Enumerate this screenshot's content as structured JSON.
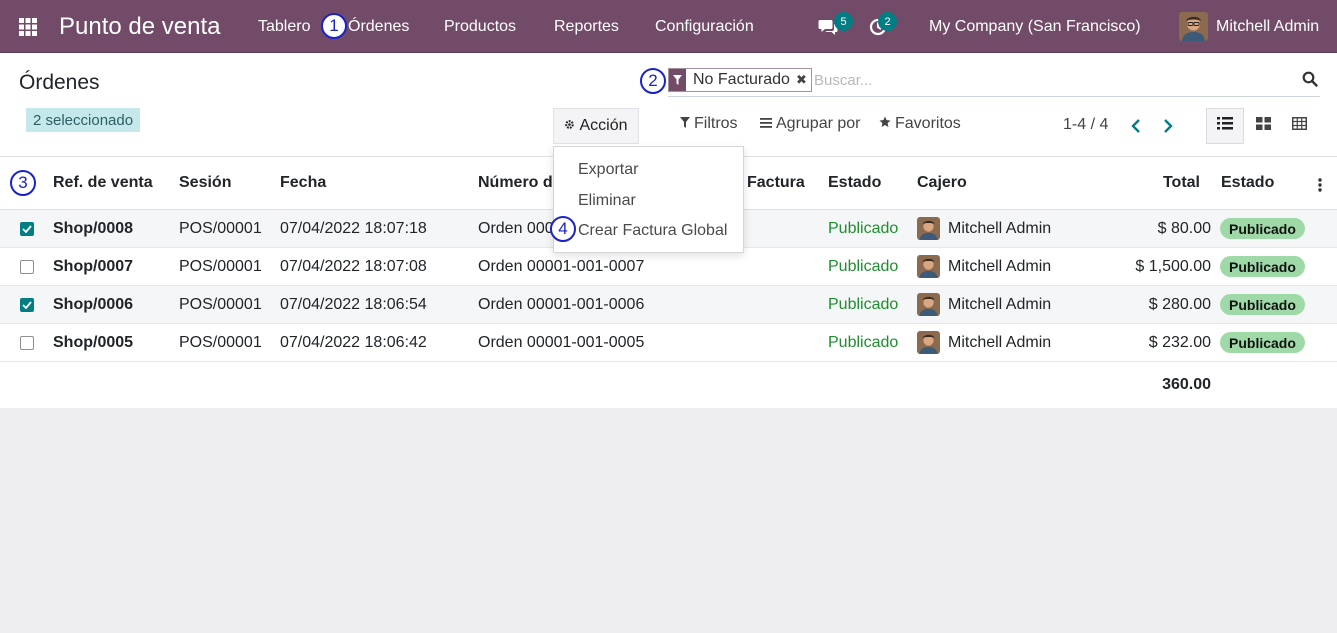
{
  "navbar": {
    "brand": "Punto de venta",
    "menu": [
      "Tablero",
      "Órdenes",
      "Productos",
      "Reportes",
      "Configuración"
    ],
    "messages_count": "5",
    "activities_count": "2",
    "company": "My Company (San Francisco)",
    "user": "Mitchell Admin"
  },
  "annotations": [
    "1",
    "2",
    "3",
    "4"
  ],
  "control_panel": {
    "title": "Órdenes",
    "selected_label": "2 seleccionado",
    "facet_label": "No Facturado",
    "search_placeholder": "Buscar...",
    "action_label": "Acción",
    "filters_label": "Filtros",
    "group_by_label": "Agrupar por",
    "favorites_label": "Favoritos",
    "pager": "1-4 / 4"
  },
  "action_menu": {
    "items": [
      "Exportar",
      "Eliminar",
      "Crear Factura Global"
    ]
  },
  "table": {
    "columns": {
      "ref": "Ref. de venta",
      "session": "Sesión",
      "date": "Fecha",
      "receipt": "Número de",
      "invoice": "Factura",
      "state": "Estado",
      "cashier": "Cajero",
      "total": "Total",
      "status": "Estado"
    },
    "rows": [
      {
        "selected": true,
        "ref": "Shop/0008",
        "session": "POS/00001",
        "date": "07/04/2022 18:07:18",
        "receipt": "Orden 0000",
        "state": "Publicado",
        "cashier": "Mitchell Admin",
        "total": "$ 80.00",
        "status": "Publicado"
      },
      {
        "selected": false,
        "ref": "Shop/0007",
        "session": "POS/00001",
        "date": "07/04/2022 18:07:08",
        "receipt": "Orden 00001-001-0007",
        "state": "Publicado",
        "cashier": "Mitchell Admin",
        "total": "$ 1,500.00",
        "status": "Publicado"
      },
      {
        "selected": true,
        "ref": "Shop/0006",
        "session": "POS/00001",
        "date": "07/04/2022 18:06:54",
        "receipt": "Orden 00001-001-0006",
        "state": "Publicado",
        "cashier": "Mitchell Admin",
        "total": "$ 280.00",
        "status": "Publicado"
      },
      {
        "selected": false,
        "ref": "Shop/0005",
        "session": "POS/00001",
        "date": "07/04/2022 18:06:42",
        "receipt": "Orden 00001-001-0005",
        "state": "Publicado",
        "cashier": "Mitchell Admin",
        "total": "$ 232.00",
        "status": "Publicado"
      }
    ],
    "grand_total": "360.00"
  },
  "colors": {
    "brand": "#714b67",
    "accent": "#017e84",
    "status_green": "#1f8e2f",
    "pill_green": "#9fd9a8",
    "annotation_blue": "#1a23c9"
  }
}
